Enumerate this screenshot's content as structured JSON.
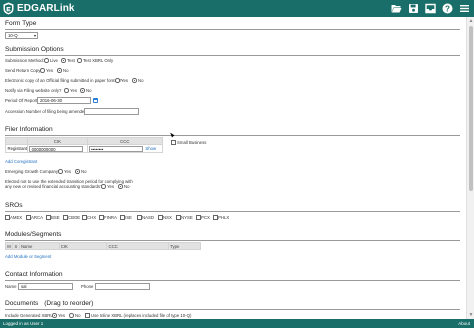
{
  "app": {
    "title": "EDGARLink"
  },
  "toolbar": {
    "icons": [
      "folder-open-icon",
      "save-icon",
      "inbox-icon",
      "help-icon",
      "menu-icon"
    ]
  },
  "form_type": {
    "heading": "Form Type",
    "selected": "10-Q"
  },
  "submission": {
    "heading": "Submission Options",
    "submission_method_label": "Submission Method:",
    "method_options": [
      "Live",
      "Test",
      "Test XBRL Only"
    ],
    "method_selected": "Test",
    "send_return_copy_label": "Send Return Copy:",
    "yes": "Yes",
    "no": "No",
    "electronic_copy_label": "Electronic copy of an Official filing submitted in paper format?",
    "notify_label": "Notify via Filing website only?",
    "period_label": "Period Of Report:",
    "period_value": "2016-06-30",
    "accession_label": "Accession Number of filing being amended:",
    "accession_value": ""
  },
  "filer": {
    "heading": "Filer Information",
    "columns": [
      "CIK",
      "CCC"
    ],
    "row_label": "Registrant",
    "cik_value": "0000000000",
    "ccc_value": "••••••••",
    "show_label": "Show",
    "small_business_label": "Small Business",
    "add_coregistrant": "Add Coregistrant",
    "egc_label": "Emerging Growth Company?",
    "elected_label_1": "Elected not to use the extended transition period for complying with",
    "elected_label_2": "any new or revised financial accounting standards?"
  },
  "sros": {
    "heading": "SROs",
    "items": [
      "AMEX",
      "ARCA",
      "BSE",
      "CBOE",
      "CHX",
      "FINRA",
      "ISE",
      "NASD",
      "NSX",
      "NYSE",
      "PCX",
      "PHLX"
    ]
  },
  "modules": {
    "heading": "Modules/Segments",
    "columns": [
      "M",
      "S",
      "Name",
      "CIK",
      "CCC",
      "Type"
    ],
    "add_link": "Add Module or Segment"
  },
  "contact": {
    "heading": "Contact Information",
    "name_label": "Name",
    "name_value": "sal",
    "phone_label": "Phone",
    "phone_value": ""
  },
  "documents": {
    "heading": "Documents",
    "heading_note": "(Drag to reorder)",
    "include_xbrl_label": "Include Generated XBRL:",
    "use_inline_label": "Use Inline XBRL (replaces included file of type 10-Q)"
  },
  "footer": {
    "status": "Logged in as User 1",
    "about": "About"
  },
  "colors": {
    "topbar": "#1a6e69",
    "link": "#1f6fbf"
  }
}
